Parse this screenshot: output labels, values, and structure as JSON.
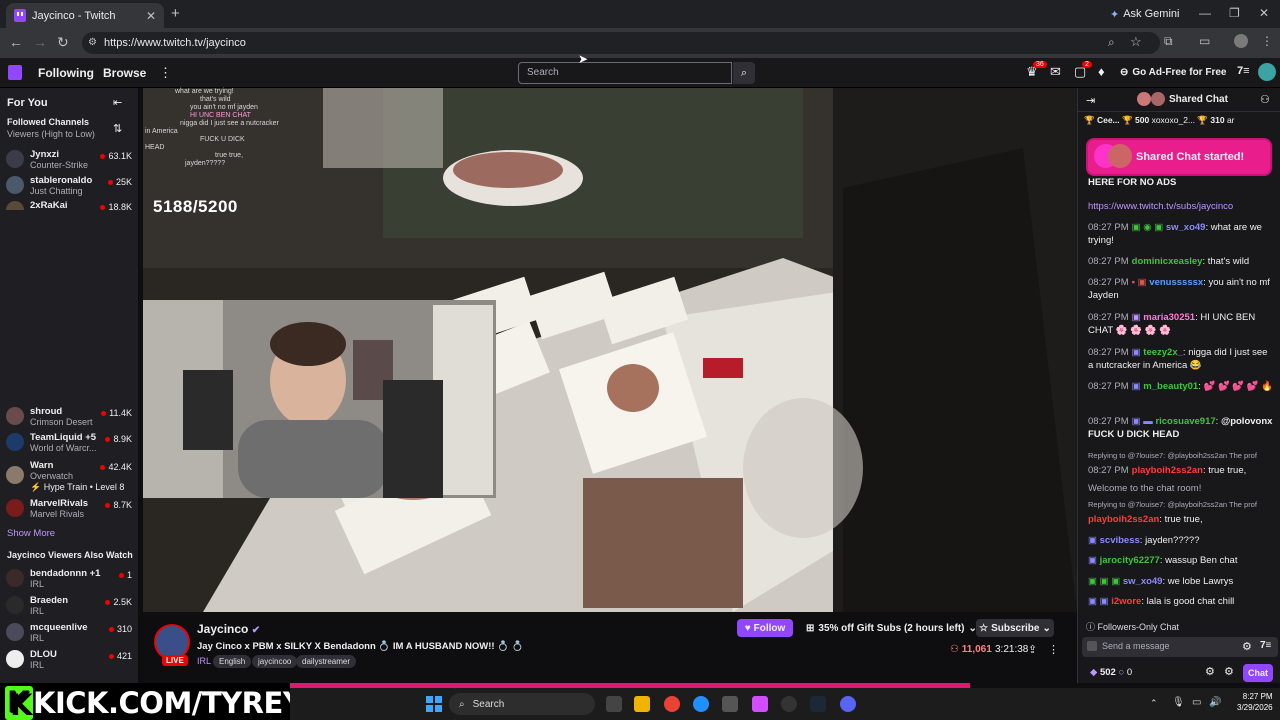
{
  "browser": {
    "tab_title": "Jaycinco - Twitch",
    "url": "https://www.twitch.tv/jaycinco",
    "ask_gemini": "Ask Gemini"
  },
  "topnav": {
    "following": "Following",
    "browse": "Browse",
    "search_placeholder": "Search",
    "notif_count": "36",
    "whisper_count": "2",
    "ad_free": "Go Ad-Free for Free"
  },
  "sidebar": {
    "for_you": "For You",
    "followed_channels": "Followed Channels",
    "sort": "Viewers (High to Low)",
    "channels": [
      {
        "name": "Jynxzi",
        "game": "Counter-Strike",
        "viewers": "63.1K"
      },
      {
        "name": "stableronaldo",
        "game": "Just Chatting",
        "viewers": "25K"
      },
      {
        "name": "2xRaKai",
        "game": "",
        "viewers": "18.8K"
      },
      {
        "name": "shroud",
        "game": "Crimson Desert",
        "viewers": "11.4K"
      },
      {
        "name": "TeamLiquid +5",
        "game": "World of Warcr...",
        "viewers": "8.9K"
      },
      {
        "name": "Warn",
        "game": "Overwatch",
        "viewers": "42.4K",
        "extra": "Hype Train • Level 8"
      },
      {
        "name": "MarvelRivals",
        "game": "Marvel Rivals",
        "viewers": "8.7K"
      }
    ],
    "show_more": "Show More",
    "also_watch_title": "Jaycinco Viewers Also Watch",
    "also_watch": [
      {
        "name": "bendadonnn +1",
        "game": "IRL",
        "viewers": "1"
      },
      {
        "name": "Braeden",
        "game": "IRL",
        "viewers": "2.5K"
      },
      {
        "name": "mcqueenlive",
        "game": "IRL",
        "viewers": "310"
      },
      {
        "name": "DLOU",
        "game": "IRL",
        "viewers": "421"
      }
    ]
  },
  "video": {
    "counter": "5188/5200",
    "overlay_lines": [
      "what are we trying!",
      "that's wild",
      "you ain't no mf jayden",
      "HI UNC BEN CHAT",
      "nigga did I just see a nutcracker",
      "in America",
      "FUCK U DICK",
      "HEAD",
      "true true,",
      "jayden?????"
    ]
  },
  "stream": {
    "streamer": "Jaycinco",
    "live": "LIVE",
    "title": "Jay Cinco x PBM x SILKY X Bendadonn 💍 IM A HUSBAND NOW!! 💍 💍",
    "category": "IRL",
    "tags": [
      "English",
      "jaycincoo",
      "dailystreamer"
    ],
    "follow": "Follow",
    "gift_subs": "35% off Gift Subs (2 hours left)",
    "subscribe": "Subscribe",
    "viewers": "11,061",
    "uptime": "3:21:38"
  },
  "chat": {
    "header": "Shared Chat",
    "leaderboard": [
      "Cee...",
      "500",
      "xoxoxo_2...",
      "310",
      "ar"
    ],
    "shared_started": "Shared Chat started!",
    "promo_line1": "HERE FOR NO ADS",
    "promo_link": "https://www.twitch.tv/subs/jaycinco",
    "messages": [
      {
        "time": "08:27 PM",
        "user": "sw_xo49",
        "color": "#8a8aff",
        "text": "what are we trying!"
      },
      {
        "time": "08:27 PM",
        "user": "dominicxeasley",
        "color": "#3ec43e",
        "text": "that's wild"
      },
      {
        "time": "08:27 PM",
        "user": "venusssssx",
        "color": "#5b9bff",
        "text": "you ain't no mf Jayden"
      },
      {
        "time": "08:27 PM",
        "user": "maria30251",
        "color": "#ff7ad9",
        "text": "HI UNC BEN CHAT 🌸 🌸 🌸 🌸"
      },
      {
        "time": "08:27 PM",
        "user": "teezy2x_",
        "color": "#3ec43e",
        "text": "nigga did I just see a nutcracker in America 😂"
      },
      {
        "time": "08:27 PM",
        "user": "m_beauty01",
        "color": "#3ec43e",
        "text": "💕 💕 💕 💕 🔥"
      },
      {
        "time": "08:27 PM",
        "user": "ricosuave917",
        "color": "#3ec43e",
        "text": "@polovonx FUCK U DICK HEAD"
      }
    ],
    "reply1": "Replying to @7louise7: @playboih2ss2an The prof",
    "msg_reply1": {
      "time": "08:27 PM",
      "user": "playboih2ss2an",
      "color": "#ff3b3b",
      "text": "true true,"
    },
    "welcome": "Welcome to the chat room!",
    "reply2": "Replying to @7louise7: @playboih2ss2an The prof",
    "msg_reply2": {
      "user": "playboih2ss2an",
      "color": "#ff3b3b",
      "text": "true true,"
    },
    "tail": [
      {
        "user": "scvibess",
        "color": "#8a8aff",
        "text": "jayden?????"
      },
      {
        "user": "jarocity62277",
        "color": "#3ec43e",
        "text": "wassup Ben chat"
      },
      {
        "user": "sw_xo49",
        "color": "#8a8aff",
        "text": "we lobe Lawrys"
      },
      {
        "user": "i2wore",
        "color": "#ff3b3b",
        "text": "lala is good chat chill"
      }
    ],
    "followers_only": "Followers-Only Chat",
    "send_placeholder": "Send a message",
    "points": "502",
    "zero": "0",
    "chat_button": "Chat"
  },
  "overlay_brand": {
    "k": "K",
    "text": "KICK.COM/TYREYES"
  },
  "taskbar": {
    "search": "Search",
    "time": "8:27 PM",
    "date": "3/29/2026"
  }
}
